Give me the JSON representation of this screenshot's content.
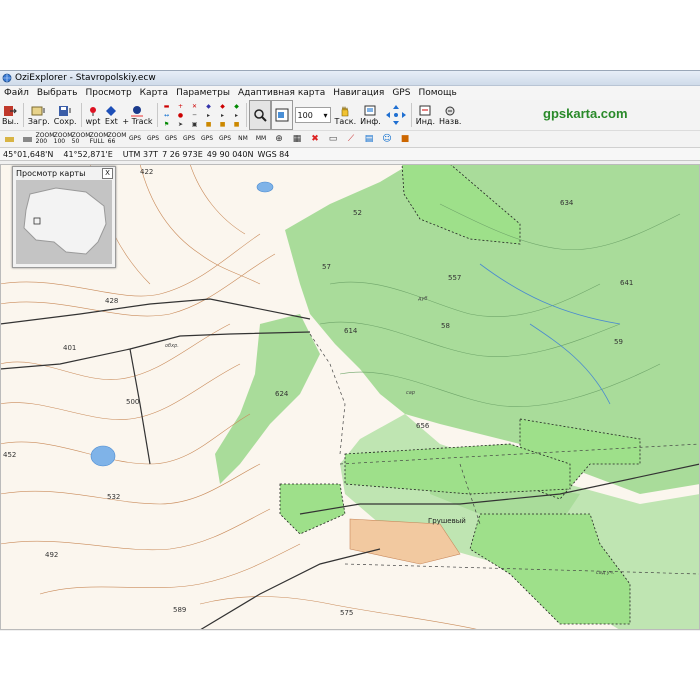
{
  "window": {
    "title": "OziExplorer - Stavropolskiy.ecw"
  },
  "menu": [
    "Файл",
    "Выбрать",
    "Просмотр",
    "Карта",
    "Параметры",
    "Адаптивная карта",
    "Навигация",
    "GPS",
    "Помощь"
  ],
  "toolbar": {
    "buttons": [
      {
        "label": "Вы..",
        "icon": "exit-icon"
      },
      {
        "label": "Загр.",
        "icon": "load-map-icon"
      },
      {
        "label": "Сохр.",
        "icon": "save-icon"
      },
      {
        "label": "wpt",
        "icon": "waypoint-icon"
      },
      {
        "label": "Ext",
        "icon": "ext-icon"
      },
      {
        "label": "+ Track",
        "icon": "track-icon"
      }
    ],
    "zoom_value": "100",
    "right_buttons": [
      {
        "label": "Таск.",
        "icon": "hand-icon"
      },
      {
        "label": "Инф.",
        "icon": "info-icon"
      },
      {
        "label": "Инд.",
        "icon": "index-icon"
      },
      {
        "label": "Назв.",
        "icon": "names-icon"
      }
    ],
    "brand": "gpskarta.com"
  },
  "toolbar2": {
    "zoom_labels": [
      "ZOOM 200",
      "ZOOM 100",
      "ZOOM 50",
      "ZOOM FULL",
      "ZOOM 66"
    ],
    "gps_labels": [
      "GPS",
      "GPS",
      "GPS",
      "GPS",
      "GPS",
      "GPS"
    ],
    "misc_labels": [
      "NM",
      "MM"
    ]
  },
  "status": {
    "lat": "45°01,648'N",
    "lon": "41°52,871'E",
    "utm": "UTM 37T",
    "easting": "7 26 973E",
    "northing": "49 90 040N",
    "datum": "WGS 84"
  },
  "overview": {
    "title": "Просмотр карты",
    "close": "X"
  },
  "map": {
    "elevations": [
      "422",
      "52",
      "634",
      "557",
      "641",
      "428",
      "57",
      "614",
      "58",
      "401",
      "500",
      "624",
      "656",
      "59",
      "452",
      "532",
      "492",
      "589",
      "575"
    ],
    "labels": [
      "Грушевый",
      "сар",
      "дуб",
      "сад уч.",
      "обхр."
    ]
  }
}
